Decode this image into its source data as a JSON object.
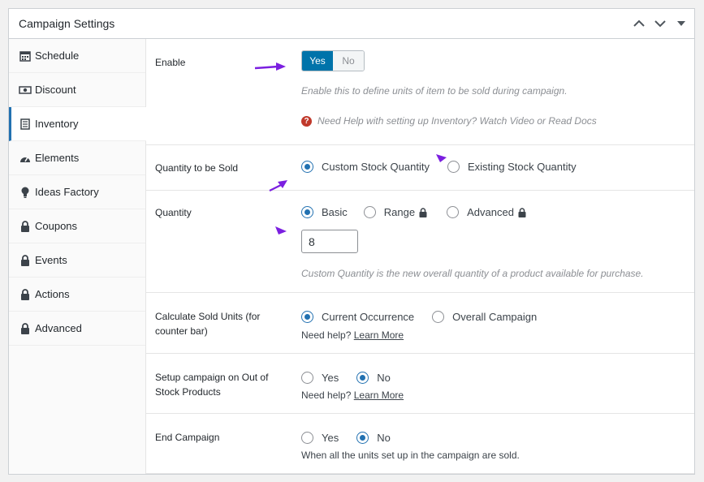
{
  "panel": {
    "title": "Campaign Settings"
  },
  "sidebar": {
    "items": [
      {
        "label": "Schedule",
        "icon": "calendar-icon"
      },
      {
        "label": "Discount",
        "icon": "money-icon"
      },
      {
        "label": "Inventory",
        "icon": "document-icon",
        "active": true
      },
      {
        "label": "Elements",
        "icon": "gauge-icon"
      },
      {
        "label": "Ideas Factory",
        "icon": "lightbulb-icon"
      },
      {
        "label": "Coupons",
        "icon": "lock-icon"
      },
      {
        "label": "Events",
        "icon": "lock-icon"
      },
      {
        "label": "Actions",
        "icon": "lock-icon"
      },
      {
        "label": "Advanced",
        "icon": "lock-icon"
      }
    ]
  },
  "enable": {
    "label": "Enable",
    "yes": "Yes",
    "no": "No",
    "selected": "Yes",
    "description": "Enable this to define units of item to be sold during campaign.",
    "help": "Need Help with setting up Inventory? Watch Video or Read Docs"
  },
  "quantity_to_sold": {
    "label": "Quantity to be Sold",
    "options": [
      "Custom Stock Quantity",
      "Existing Stock Quantity"
    ],
    "selected": "Custom Stock Quantity"
  },
  "quantity": {
    "label": "Quantity",
    "options": [
      "Basic",
      "Range",
      "Advanced"
    ],
    "selected": "Basic",
    "value": "8",
    "description": "Custom Quantity is the new overall quantity of a product available for purchase."
  },
  "calc_sold": {
    "label": "Calculate Sold Units (for counter bar)",
    "options": [
      "Current Occurrence",
      "Overall Campaign"
    ],
    "selected": "Current Occurrence",
    "help_prefix": "Need help?",
    "help_link": "Learn More"
  },
  "out_of_stock": {
    "label": "Setup campaign on Out of Stock Products",
    "options": [
      "Yes",
      "No"
    ],
    "selected": "No",
    "help_prefix": "Need help?",
    "help_link": "Learn More"
  },
  "end_campaign": {
    "label": "End Campaign",
    "options": [
      "Yes",
      "No"
    ],
    "selected": "No",
    "description": "When all the units set up in the campaign are sold."
  },
  "colors": {
    "accent": "#2271b1",
    "toggle_on": "#0073aa",
    "annotation_arrow": "#7b1fe0",
    "help_icon": "#c0392b"
  }
}
